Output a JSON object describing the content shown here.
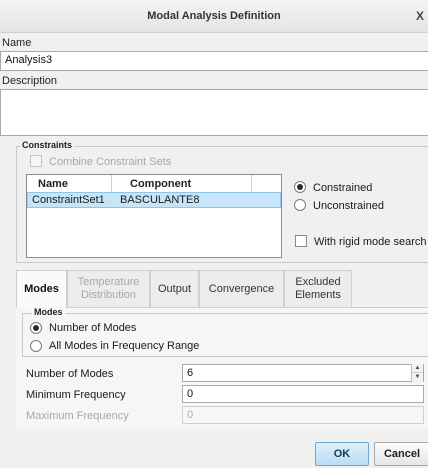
{
  "window": {
    "title": "Modal Analysis Definition",
    "close_glyph": "X"
  },
  "name": {
    "label": "Name",
    "value": "Analysis3"
  },
  "description": {
    "label": "Description",
    "value": ""
  },
  "constraints": {
    "group_title": "Constraints",
    "combine_label": "Combine Constraint Sets",
    "table": {
      "headers": [
        "Name",
        "Component"
      ],
      "rows": [
        {
          "name": "ConstraintSet1",
          "component": "BASCULANTE8"
        }
      ]
    },
    "options": [
      "Constrained",
      "Unconstrained"
    ],
    "selected_option": "Constrained",
    "rigid_label": "With rigid mode search"
  },
  "tabs": [
    {
      "label": "Modes"
    },
    {
      "label": "Temperature Distribution"
    },
    {
      "label": "Output"
    },
    {
      "label": "Convergence"
    },
    {
      "label": "Excluded Elements"
    }
  ],
  "active_tab": "Modes",
  "modes": {
    "group_title": "Modes",
    "options": [
      "Number of Modes",
      "All Modes in Frequency Range"
    ],
    "selected_option": "Number of Modes",
    "fields": {
      "number_of_modes": {
        "label": "Number of Modes",
        "value": "6"
      },
      "min_frequency": {
        "label": "Minimum Frequency",
        "value": "0"
      },
      "max_frequency": {
        "label": "Maximum Frequency",
        "value": "0"
      }
    }
  },
  "buttons": {
    "ok": "OK",
    "cancel": "Cancel"
  }
}
